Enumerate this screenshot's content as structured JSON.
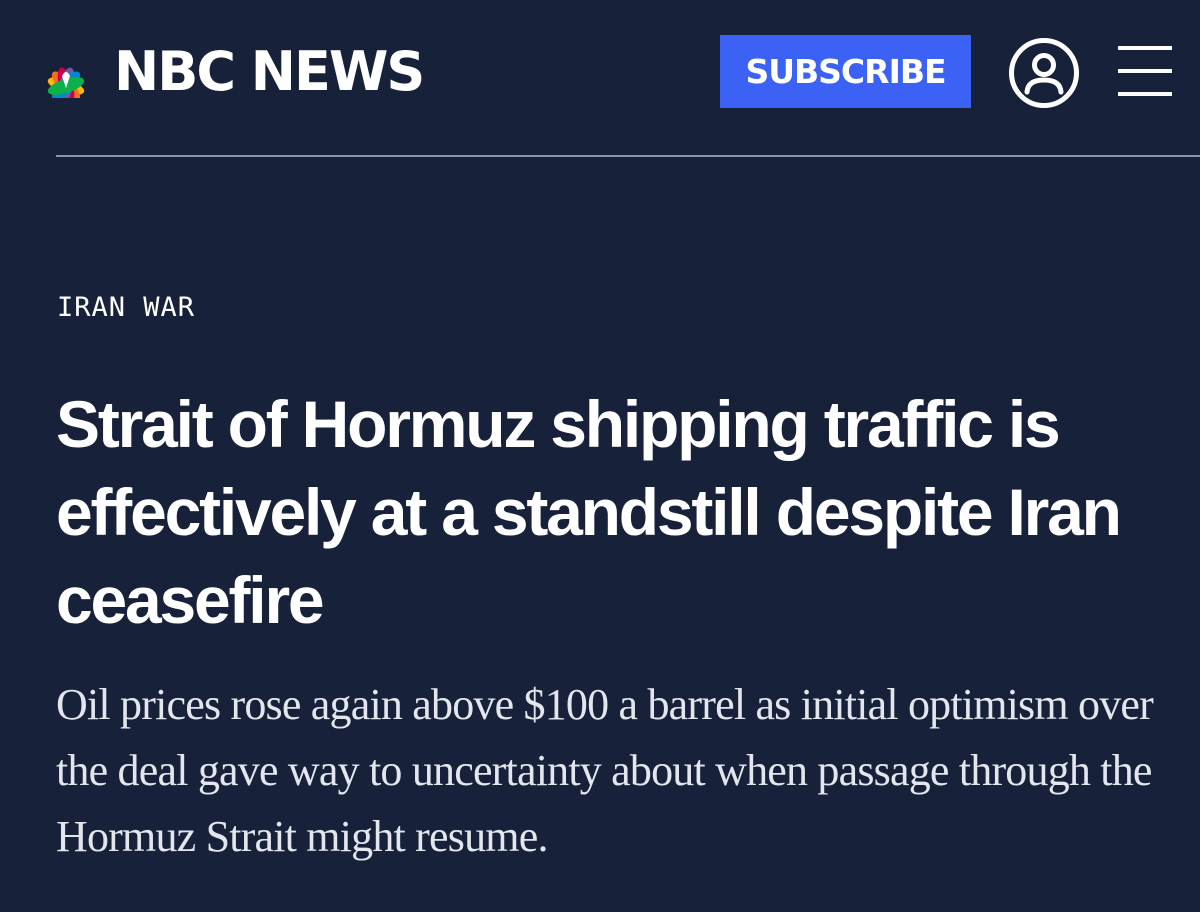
{
  "brand": {
    "wordmark": "NBC NEWS",
    "peacock_colors": [
      "#fcb711",
      "#f37021",
      "#cc004c",
      "#6460aa",
      "#0089d0",
      "#0db14b"
    ]
  },
  "header": {
    "subscribe_label": "SUBSCRIBE",
    "account_icon": "user-circle-icon",
    "menu_icon": "hamburger-menu-icon"
  },
  "article": {
    "kicker": "IRAN WAR",
    "headline": "Strait of Hormuz shipping traffic is effectively at a standstill despite Iran ceasefire",
    "dek": "Oil prices rose again above $100 a barrel as initial optimism over the deal gave way to uncertainty about when passage through the Hormuz Strait might resume."
  },
  "colors": {
    "background": "#17213a",
    "subscribe_button": "#3c62f5",
    "text": "#ffffff"
  }
}
